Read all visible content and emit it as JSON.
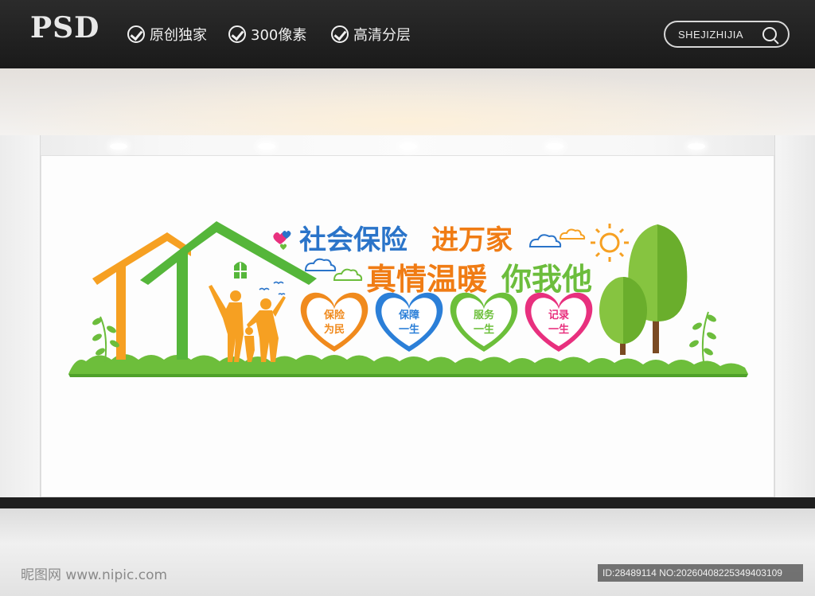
{
  "header": {
    "logo": "PSD",
    "badges": [
      "原创独家",
      "300像素",
      "高清分层"
    ],
    "search_label": "SHEJIZHIJIA"
  },
  "artwork": {
    "title_line1_a": "社会保险",
    "title_line1_b": "进万家",
    "title_line2_a": "真情温暖",
    "title_line2_b": "你我他",
    "hearts": [
      {
        "line1": "保险",
        "line2": "为民",
        "color": "#f08a1d"
      },
      {
        "line1": "保障",
        "line2": "一生",
        "color": "#2b7fd8"
      },
      {
        "line1": "服务",
        "line2": "一生",
        "color": "#6cbf3a"
      },
      {
        "line1": "记录",
        "line2": "一生",
        "color": "#e8307e"
      }
    ],
    "colors": {
      "blue": "#2a74c9",
      "orange": "#f07c14",
      "green": "#6cbd3c",
      "house_orange": "#f6a022",
      "house_green": "#55b63a"
    }
  },
  "footer": {
    "watermark": "昵图网 www.nipic.com",
    "id_text": "ID:28489114 NO:20260408225349403109"
  }
}
